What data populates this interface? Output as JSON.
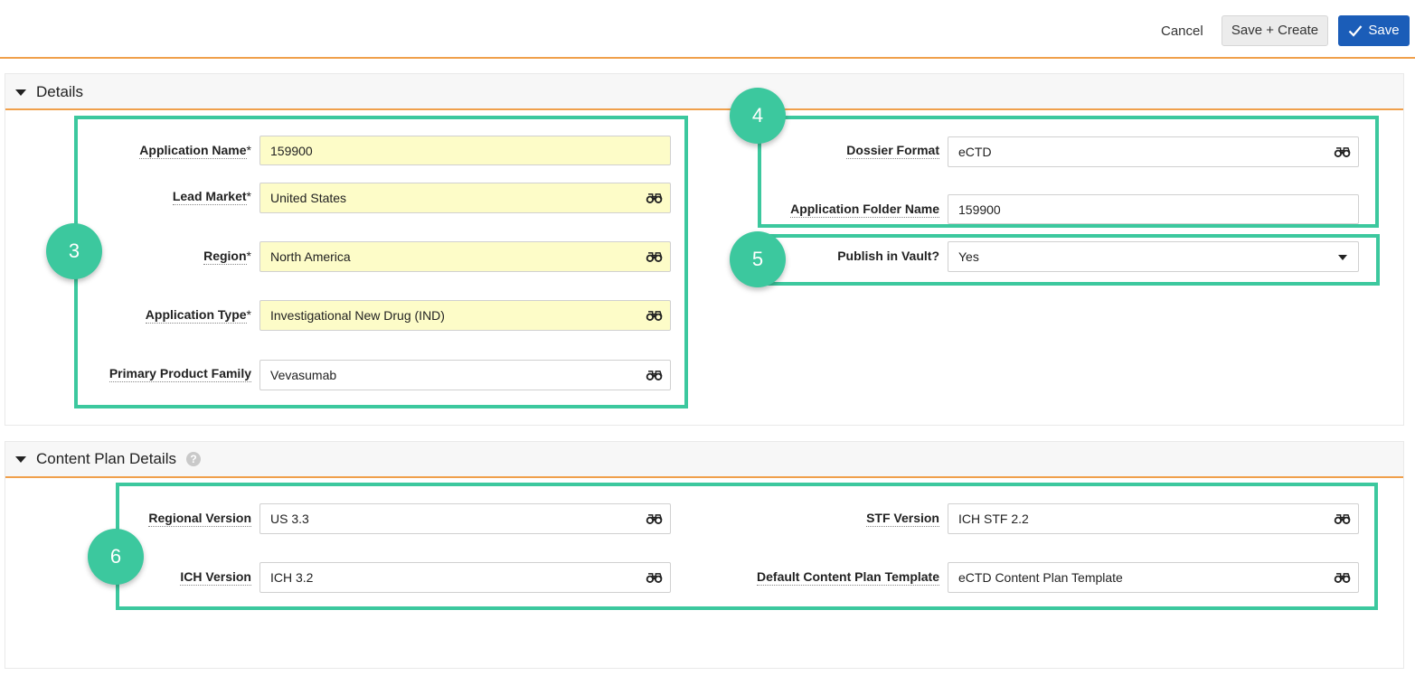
{
  "toolbar": {
    "cancel_label": "Cancel",
    "save_create_label": "Save + Create",
    "save_label": "Save"
  },
  "details": {
    "title": "Details",
    "fields": {
      "application_name": {
        "label": "Application Name",
        "required": "*",
        "value": "159900"
      },
      "lead_market": {
        "label": "Lead Market",
        "required": "*",
        "value": "United States"
      },
      "region": {
        "label": "Region",
        "required": "*",
        "value": "North America"
      },
      "application_type": {
        "label": "Application Type",
        "required": "*",
        "value": "Investigational New Drug (IND)"
      },
      "primary_product_family": {
        "label": "Primary Product Family",
        "value": "Vevasumab"
      },
      "dossier_format": {
        "label": "Dossier Format",
        "value": "eCTD"
      },
      "application_folder_name": {
        "label": "Application Folder Name",
        "value": "159900"
      },
      "publish_in_vault": {
        "label": "Publish in Vault?",
        "value": "Yes"
      }
    }
  },
  "content_plan": {
    "title": "Content Plan Details",
    "help_icon": "?",
    "fields": {
      "regional_version": {
        "label": "Regional Version",
        "value": "US 3.3"
      },
      "ich_version": {
        "label": "ICH Version",
        "value": "ICH 3.2"
      },
      "stf_version": {
        "label": "STF Version",
        "value": "ICH STF 2.2"
      },
      "default_content_plan_template": {
        "label": "Default Content Plan Template",
        "value": "eCTD Content Plan Template"
      }
    }
  },
  "callouts": [
    "3",
    "4",
    "5",
    "6"
  ],
  "colors": {
    "accent_orange": "#f0a04b",
    "save_blue": "#1b5db8",
    "callout_green": "#3cc89e",
    "required_yellow": "#fdfcc8"
  },
  "icons": {
    "lookup": "binoculars-icon",
    "dropdown": "chevron-down-icon",
    "save": "check-icon",
    "section_toggle": "caret-down-icon"
  }
}
